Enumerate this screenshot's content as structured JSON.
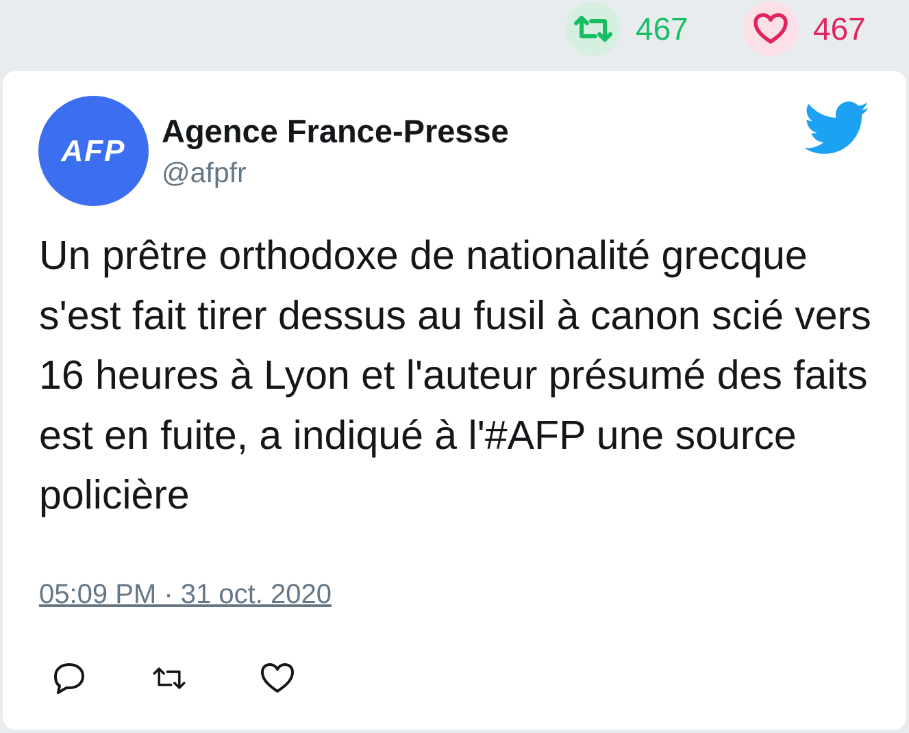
{
  "stats": {
    "retweet_count": "467",
    "like_count": "467"
  },
  "tweet": {
    "author": {
      "name": "Agence France-Presse",
      "handle": "@afpfr",
      "avatar_text": "AFP"
    },
    "text": "Un prêtre orthodoxe de nationalité grecque s'est fait tirer dessus au fusil à canon scié vers 16 heures à Lyon et l'auteur présumé des faits est en fuite, a indiqué à l'#AFP une source policière",
    "timestamp": "05:09 PM · 31 oct. 2020"
  },
  "icons": {
    "retweet": "retweet-icon",
    "like": "heart-icon",
    "reply": "reply-icon",
    "brand": "twitter-bird-icon"
  },
  "colors": {
    "retweet": "#17bf63",
    "like": "#e0245e",
    "twitter_blue": "#1da1f2",
    "avatar_bg": "#3b6ff0",
    "secondary_text": "#657786"
  }
}
